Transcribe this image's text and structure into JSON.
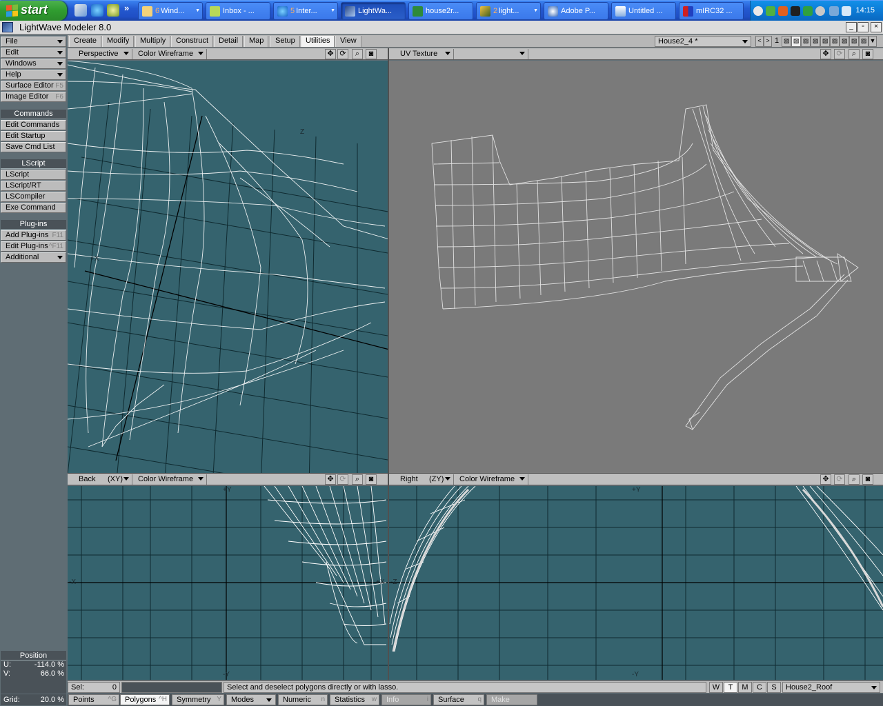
{
  "taskbar": {
    "start_label": "start",
    "tasks": [
      {
        "num": "6",
        "label": "Wind...",
        "arrow": "▼"
      },
      {
        "num": "",
        "label": "Inbox - ...",
        "arrow": ""
      },
      {
        "num": "5",
        "label": "Inter...",
        "arrow": "▼"
      },
      {
        "num": "",
        "label": "LightWa...",
        "arrow": ""
      },
      {
        "num": "",
        "label": "house2r...",
        "arrow": ""
      },
      {
        "num": "2",
        "label": "light...",
        "arrow": "▼"
      },
      {
        "num": "",
        "label": "Adobe P...",
        "arrow": ""
      },
      {
        "num": "",
        "label": "Untitled ...",
        "arrow": ""
      },
      {
        "num": "",
        "label": "mIRC32 ...",
        "arrow": ""
      }
    ],
    "clock": "14:15",
    "chevron": "»"
  },
  "window": {
    "title": "LightWave Modeler 8.0",
    "min": "_",
    "max": "▫",
    "close": "×"
  },
  "tabs": [
    {
      "label": "Create"
    },
    {
      "label": "Modify"
    },
    {
      "label": "Multiply"
    },
    {
      "label": "Construct"
    },
    {
      "label": "Detail"
    },
    {
      "label": "Map"
    },
    {
      "label": "Setup"
    },
    {
      "label": "Utilities",
      "active": true
    },
    {
      "label": "View"
    }
  ],
  "object_selector": "House2_4 *",
  "layer_number": "1",
  "sidebar": {
    "menus": [
      {
        "label": "File",
        "arrow": true
      },
      {
        "label": "Edit",
        "arrow": true
      },
      {
        "label": "Windows",
        "arrow": true
      },
      {
        "label": "Help",
        "arrow": true
      },
      {
        "label": "Surface Editor",
        "shortcut": "F5"
      },
      {
        "label": "Image Editor",
        "shortcut": "F6"
      }
    ],
    "commands_header": "Commands",
    "commands": [
      {
        "label": "Edit Commands"
      },
      {
        "label": "Edit Startup"
      },
      {
        "label": "Save Cmd List"
      }
    ],
    "lscript_header": "LScript",
    "lscript": [
      {
        "label": "LScript"
      },
      {
        "label": "LScript/RT"
      },
      {
        "label": "LSCompiler"
      },
      {
        "label": "Exe Command"
      }
    ],
    "plugins_header": "Plug-ins",
    "plugins": [
      {
        "label": "Add Plug-ins",
        "shortcut": "F11"
      },
      {
        "label": "Edit Plug-ins",
        "shortcut": "^F11"
      },
      {
        "label": "Additional",
        "arrow": true
      }
    ]
  },
  "position": {
    "header": "Position",
    "u_label": "U:",
    "u_value": "-114.0 %",
    "v_label": "V:",
    "v_value": "66.0 %"
  },
  "grid": {
    "label": "Grid:",
    "value": "20.0 %"
  },
  "viewports": {
    "top_left": {
      "view": "Perspective",
      "render": "Color Wireframe",
      "axis_z": "Z",
      "axis_x": "+X"
    },
    "top_right": {
      "view": "UV Texture",
      "map": ""
    },
    "bottom_left": {
      "view": "Back",
      "plane": "(XY)",
      "render": "Color Wireframe",
      "axis_top": "+Y",
      "axis_bottom": "-Y",
      "axis_left": "-X",
      "axis_right": "+X"
    },
    "bottom_right": {
      "view": "Right",
      "plane": "(ZY)",
      "render": "Color Wireframe",
      "axis_top": "+Y",
      "axis_bottom": "-Y",
      "axis_left": "-Z"
    }
  },
  "viewport_icons": {
    "move": "✥",
    "rotate": "⟳",
    "zoom": "⌕",
    "maximize": "◙"
  },
  "status": {
    "sel_label": "Sel:",
    "sel_value": "0",
    "message": "Select and deselect polygons directly or with lasso.",
    "wtmcs": [
      "W",
      "T",
      "M",
      "C",
      "S"
    ],
    "surface": "House2_Roof"
  },
  "modes": [
    {
      "label": "Points",
      "shortcut": "^G"
    },
    {
      "label": "Polygons",
      "shortcut": "^H",
      "active": true
    },
    {
      "label": "Symmetry",
      "shortcut": "Y"
    },
    {
      "label": "Modes",
      "arrow": true
    },
    {
      "label": "Numeric",
      "shortcut": "n"
    },
    {
      "label": "Statistics",
      "shortcut": "w"
    },
    {
      "label": "Info",
      "shortcut": "i",
      "dim": true
    },
    {
      "label": "Surface",
      "shortcut": "q"
    },
    {
      "label": "Make",
      "dim": true
    }
  ],
  "colors": {
    "viewport_bg": "#35636e",
    "uv_bg": "#7a7a7a",
    "wire": "#ffffff",
    "panel": "#5f6d74"
  }
}
